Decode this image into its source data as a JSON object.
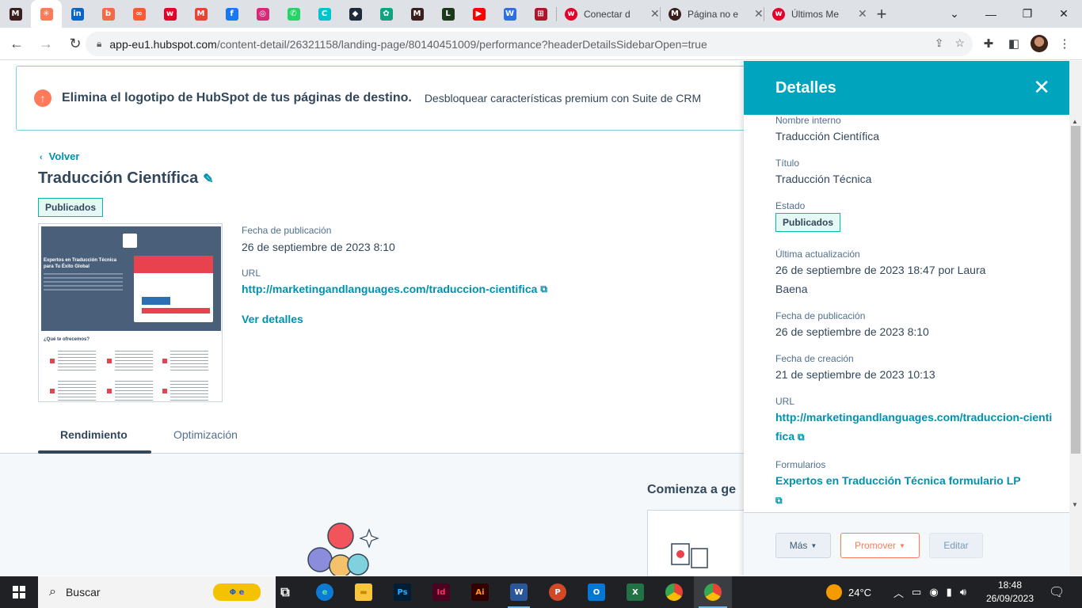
{
  "browser": {
    "tabs": [
      {
        "icon": "marketing-languages-favicon",
        "color": "#3b1f1f",
        "glyph": "M"
      },
      {
        "icon": "hubspot-favicon",
        "color": "#ff7a59",
        "glyph": "✳"
      },
      {
        "icon": "linkedin-favicon",
        "color": "#0a66c2",
        "glyph": "in"
      },
      {
        "icon": "pinterest-like-favicon",
        "color": "#f26a4b",
        "glyph": "b"
      },
      {
        "icon": "infinity-favicon",
        "color": "#ff5a36",
        "glyph": "∞"
      },
      {
        "icon": "w-favicon",
        "color": "#e4002b",
        "glyph": "w"
      },
      {
        "icon": "gmail-favicon",
        "color": "#ea4335",
        "glyph": "M"
      },
      {
        "icon": "facebook-favicon",
        "color": "#1877f2",
        "glyph": "f"
      },
      {
        "icon": "instagram-favicon",
        "color": "#d62976",
        "glyph": "◎"
      },
      {
        "icon": "whatsapp-favicon",
        "color": "#25d366",
        "glyph": "✆"
      },
      {
        "icon": "canva-favicon",
        "color": "#00c4cc",
        "glyph": "C"
      },
      {
        "icon": "shield-favicon",
        "color": "#1e2a3a",
        "glyph": "◆"
      },
      {
        "icon": "chatgpt-favicon",
        "color": "#10a37f",
        "glyph": "✿"
      },
      {
        "icon": "marketing-languages-favicon",
        "color": "#3b1f1f",
        "glyph": "M"
      },
      {
        "icon": "book-favicon",
        "color": "#1b3a1b",
        "glyph": "L"
      },
      {
        "icon": "youtube-favicon",
        "color": "#ff0000",
        "glyph": "▶"
      },
      {
        "icon": "wordpress-w-favicon",
        "color": "#2f6fde",
        "glyph": "W"
      },
      {
        "icon": "grid-favicon",
        "color": "#b0162b",
        "glyph": "⊞"
      }
    ],
    "full_tabs": [
      {
        "title": "Conectar d",
        "icon": "w-favicon",
        "color": "#e4002b",
        "glyph": "w"
      },
      {
        "title": "Página no e",
        "icon": "marketing-languages-favicon",
        "color": "#3b1f1f",
        "glyph": "M"
      },
      {
        "title": "Últimos Me",
        "icon": "w-favicon",
        "color": "#e4002b",
        "glyph": "w"
      }
    ],
    "url_host": "app-eu1.hubspot.com",
    "url_path": "/content-detail/26321158/landing-page/80140451009/performance?headerDetailsSidebarOpen=true"
  },
  "banner": {
    "title": "Elimina el logotipo de HubSpot de tus páginas de destino.",
    "subtitle": "Desbloquear características premium con Suite de CRM"
  },
  "page": {
    "back_label": "Volver",
    "title": "Traducción Científica",
    "status": "Publicados",
    "pub_label": "Fecha de publicación",
    "pub_date": "26 de septiembre de 2023 8:10",
    "url_label": "URL",
    "url": "http://marketingandlanguages.com/traduccion-cientifica",
    "details_link": "Ver detalles",
    "tabs": [
      "Rendimiento",
      "Optimización"
    ],
    "lower_heading": "Comienza a ge"
  },
  "thumbnail": {
    "hero_text": "Expertos en Traducción Técnica para Tu Éxito Global",
    "question": "¿Qué te ofrecemos?"
  },
  "panel": {
    "title": "Detalles",
    "fields": {
      "nombre_label": "Nombre interno",
      "nombre_value": "Traducción Científica",
      "titulo_label": "Título",
      "titulo_value": "Traducción Técnica",
      "estado_label": "Estado",
      "estado_value": "Publicados",
      "actualizacion_label": "Última actualización",
      "actualizacion_value": "26 de septiembre de 2023 18:47 por Laura Baena",
      "publicacion_label": "Fecha de publicación",
      "publicacion_value": "26 de septiembre de 2023 8:10",
      "creacion_label": "Fecha de creación",
      "creacion_value": "21 de septiembre de 2023 10:13",
      "url_label": "URL",
      "url_value": "http://marketingandlanguages.com/traduccion-cientifica",
      "formularios_label": "Formularios",
      "formularios_value": "Expertos en Traducción Técnica formulario LP"
    },
    "buttons": {
      "mas": "Más",
      "promover": "Promover",
      "editar": "Editar"
    }
  },
  "taskbar": {
    "search_placeholder": "Buscar",
    "weather": "24°C",
    "time": "18:48",
    "date": "26/09/2023"
  }
}
